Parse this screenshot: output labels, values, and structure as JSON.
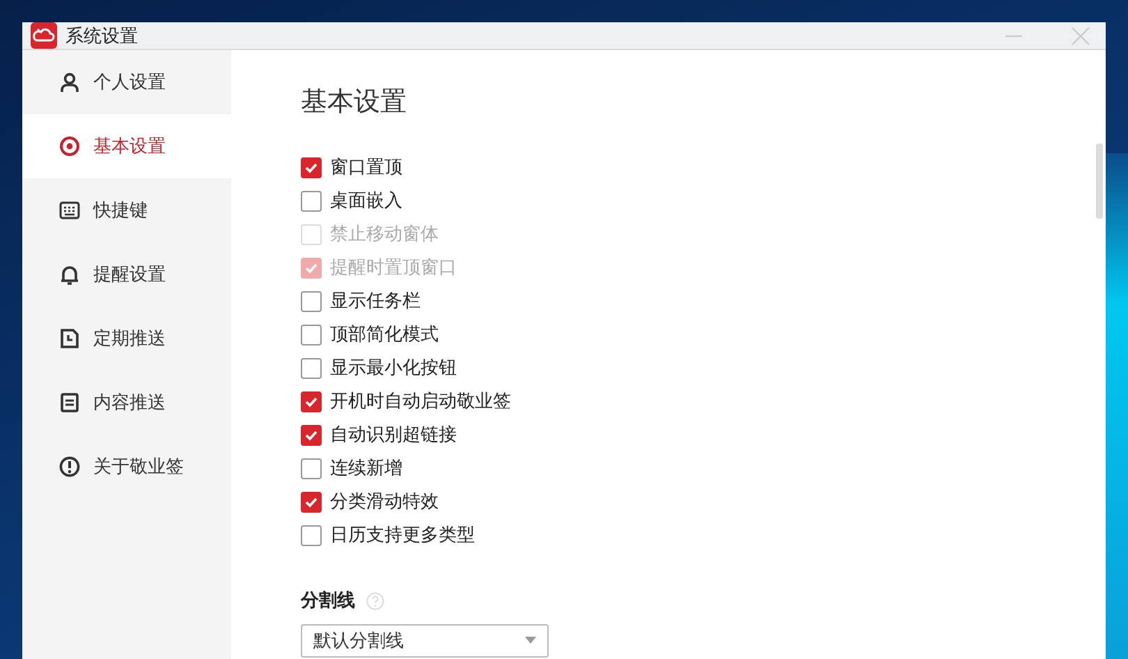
{
  "window": {
    "title": "系统设置"
  },
  "sidebar": {
    "items": [
      {
        "label": "个人设置",
        "selected": false
      },
      {
        "label": "基本设置",
        "selected": true
      },
      {
        "label": "快捷键",
        "selected": false
      },
      {
        "label": "提醒设置",
        "selected": false
      },
      {
        "label": "定期推送",
        "selected": false
      },
      {
        "label": "内容推送",
        "selected": false
      },
      {
        "label": "关于敬业签",
        "selected": false
      }
    ]
  },
  "content": {
    "heading": "基本设置",
    "options": [
      {
        "label": "窗口置顶",
        "checked": true,
        "disabled": false
      },
      {
        "label": "桌面嵌入",
        "checked": false,
        "disabled": false
      },
      {
        "label": "禁止移动窗体",
        "checked": false,
        "disabled": true
      },
      {
        "label": "提醒时置顶窗口",
        "checked": true,
        "disabled": true
      },
      {
        "label": "显示任务栏",
        "checked": false,
        "disabled": false
      },
      {
        "label": "顶部简化模式",
        "checked": false,
        "disabled": false
      },
      {
        "label": "显示最小化按钮",
        "checked": false,
        "disabled": false
      },
      {
        "label": "开机时自动启动敬业签",
        "checked": true,
        "disabled": false
      },
      {
        "label": "自动识别超链接",
        "checked": true,
        "disabled": false
      },
      {
        "label": "连续新增",
        "checked": false,
        "disabled": false
      },
      {
        "label": "分类滑动特效",
        "checked": true,
        "disabled": false
      },
      {
        "label": "日历支持更多类型",
        "checked": false,
        "disabled": false
      }
    ],
    "divider_section": {
      "label": "分割线",
      "dropdown": {
        "value": "默认分割线"
      }
    }
  }
}
